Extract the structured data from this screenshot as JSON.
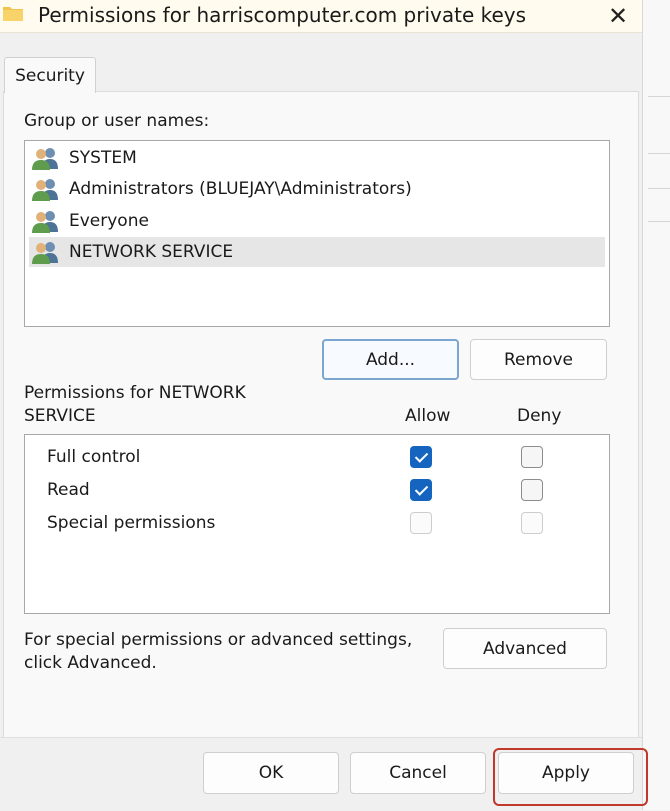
{
  "window": {
    "title": "Permissions for harriscomputer.com private keys",
    "close_glyph": "✕"
  },
  "tabs": [
    {
      "label": "Security"
    }
  ],
  "group_section": {
    "label": "Group or user names:",
    "users": [
      {
        "name": "SYSTEM",
        "selected": false
      },
      {
        "name": "Administrators (BLUEJAY\\Administrators)",
        "selected": false
      },
      {
        "name": "Everyone",
        "selected": false
      },
      {
        "name": "NETWORK SERVICE",
        "selected": true
      }
    ],
    "add_button": "Add...",
    "remove_button": "Remove"
  },
  "permissions_section": {
    "label_line1": "Permissions for NETWORK",
    "label_line2": "SERVICE",
    "allow_header": "Allow",
    "deny_header": "Deny",
    "rows": [
      {
        "name": "Full control",
        "allow": true,
        "deny": false,
        "enabled": true
      },
      {
        "name": "Read",
        "allow": true,
        "deny": false,
        "enabled": true
      },
      {
        "name": "Special permissions",
        "allow": false,
        "deny": false,
        "enabled": false
      }
    ]
  },
  "advanced_section": {
    "text_line1": "For special permissions or advanced settings,",
    "text_line2": "click Advanced.",
    "button": "Advanced"
  },
  "footer": {
    "ok": "OK",
    "cancel": "Cancel",
    "apply": "Apply"
  },
  "colors": {
    "checkbox_checked": "#1565c0",
    "highlight": "#c0392b",
    "titlebar_bg": "#fffbee"
  }
}
